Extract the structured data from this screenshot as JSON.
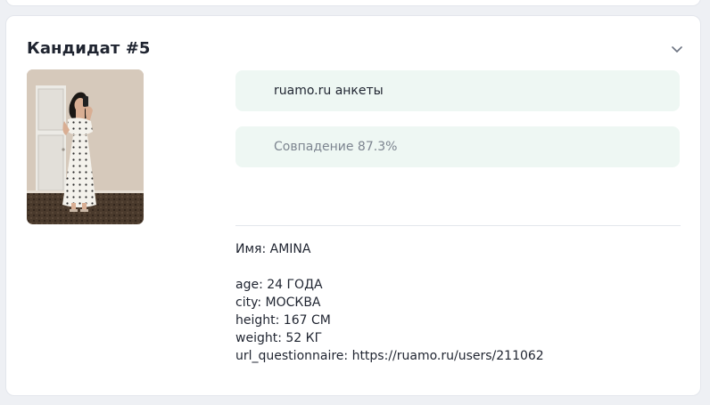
{
  "card": {
    "title": "Кандидат #5",
    "source_label": "ruamo.ru анкеты",
    "match_label": "Совпадение 87.3%",
    "toggle_icon": "chevron-down-icon",
    "photo": "candidate-photo"
  },
  "details": {
    "name": "Имя: AMINA",
    "age": "age: 24 ГОДА",
    "city": "city: МОСКВА",
    "height": "height: 167 СМ",
    "weight": "weight: 52 КГ",
    "url": "url_questionnaire: https://ruamo.ru/users/211062"
  },
  "colors": {
    "pill_background": "#eef7f3",
    "muted_text": "#7d8590",
    "card_border": "#e3e6ec"
  }
}
